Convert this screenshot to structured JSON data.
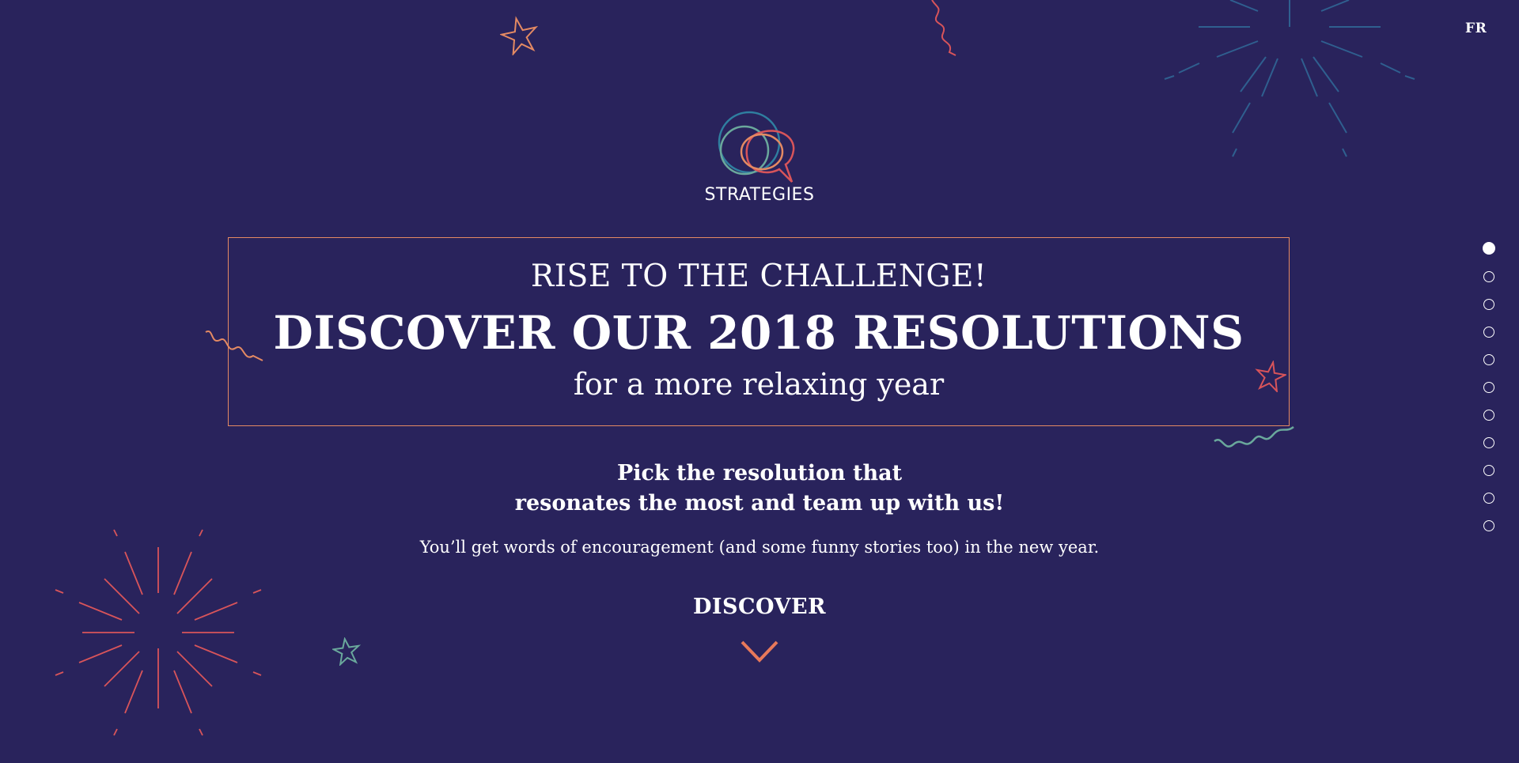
{
  "nav": {
    "language_toggle": "FR"
  },
  "logo": {
    "name": "STRATEGIES"
  },
  "hero": {
    "kicker": "RISE TO THE CHALLENGE!",
    "title": "DISCOVER OUR 2018 RESOLUTIONS",
    "subtitle": "for a more relaxing year"
  },
  "pitch": {
    "line1": "Pick the resolution that",
    "line2": "resonates the most and team up with us!"
  },
  "description": "You’ll get words of encouragement (and some funny stories too) in the new year.",
  "cta": {
    "label": "DISCOVER",
    "icon": "chevron-down-icon"
  },
  "pagination": {
    "count": 11,
    "active_index": 0
  },
  "colors": {
    "background": "#29235c",
    "accent_orange": "#e48a63",
    "accent_red": "#d8545a",
    "accent_teal": "#6aa89c",
    "accent_blue": "#2f5f8f"
  }
}
